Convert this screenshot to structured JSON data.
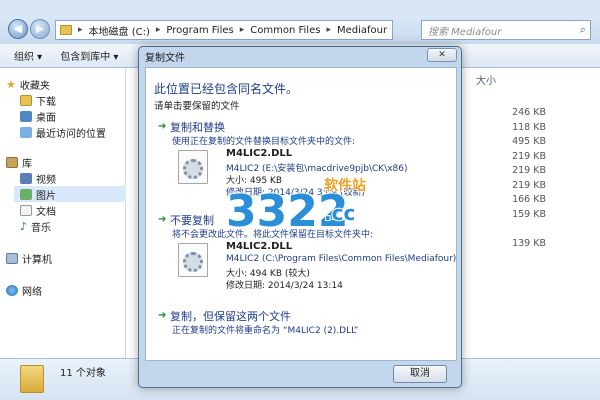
{
  "address": {
    "crumbs": [
      "本地磁盘 (C:)",
      "Program Files",
      "Common Files",
      "Mediafour"
    ],
    "separator": "▸",
    "search_placeholder": "搜索 Mediafour"
  },
  "toolbar": {
    "organize": "组织 ▾",
    "include_in_library": "包含到库中 ▾"
  },
  "nav": {
    "favorites": "收藏夹",
    "downloads": "下载",
    "desktop": "桌面",
    "recent": "最近访问的位置",
    "library": "库",
    "video": "视频",
    "pictures": "图片",
    "documents": "文档",
    "music": "音乐",
    "computer": "计算机",
    "network": "网络"
  },
  "content": {
    "size_header": "大小",
    "sizes": [
      "246 KB",
      "118 KB",
      "495 KB",
      "219 KB",
      "219 KB",
      "219 KB",
      "166 KB",
      "159 KB",
      "",
      "139 KB"
    ]
  },
  "status": {
    "count": "11 个对象"
  },
  "dialog": {
    "title": "复制文件",
    "close": "✕",
    "heading": "此位置已经包含同名文件。",
    "subheading": "请单击要保留的文件",
    "option1_title": "复制和替换",
    "option1_desc": "使用正在复制的文件替换目标文件夹中的文件:",
    "file1_name": "M4LIC2.DLL",
    "file1_path": "M4LIC2 (E:\\安装包\\macdrive9pjb\\CK\\x86)",
    "file1_size": "大小: 495 KB",
    "file1_date": "修改日期: 2014/3/24 3:09 (较新)",
    "option2_title": "不要复制",
    "option2_desc": "将不会更改此文件。将此文件保留在目标文件夹中:",
    "file2_name": "M4LIC2.DLL",
    "file2_path": "M4LIC2 (C:\\Program Files\\Common Files\\Mediafour)",
    "file2_size": "大小: 494 KB (较大)",
    "file2_date": "修改日期: 2014/3/24 13:14",
    "option3_title": "复制，但保留这两个文件",
    "option3_desc": "正在复制的文件将重命名为 “M4LIC2 (2).DLL”",
    "cancel": "取消",
    "option_arrow": "➔"
  },
  "watermark": {
    "number": "3322",
    "suffix": ".cc",
    "tagline": "软件站"
  }
}
